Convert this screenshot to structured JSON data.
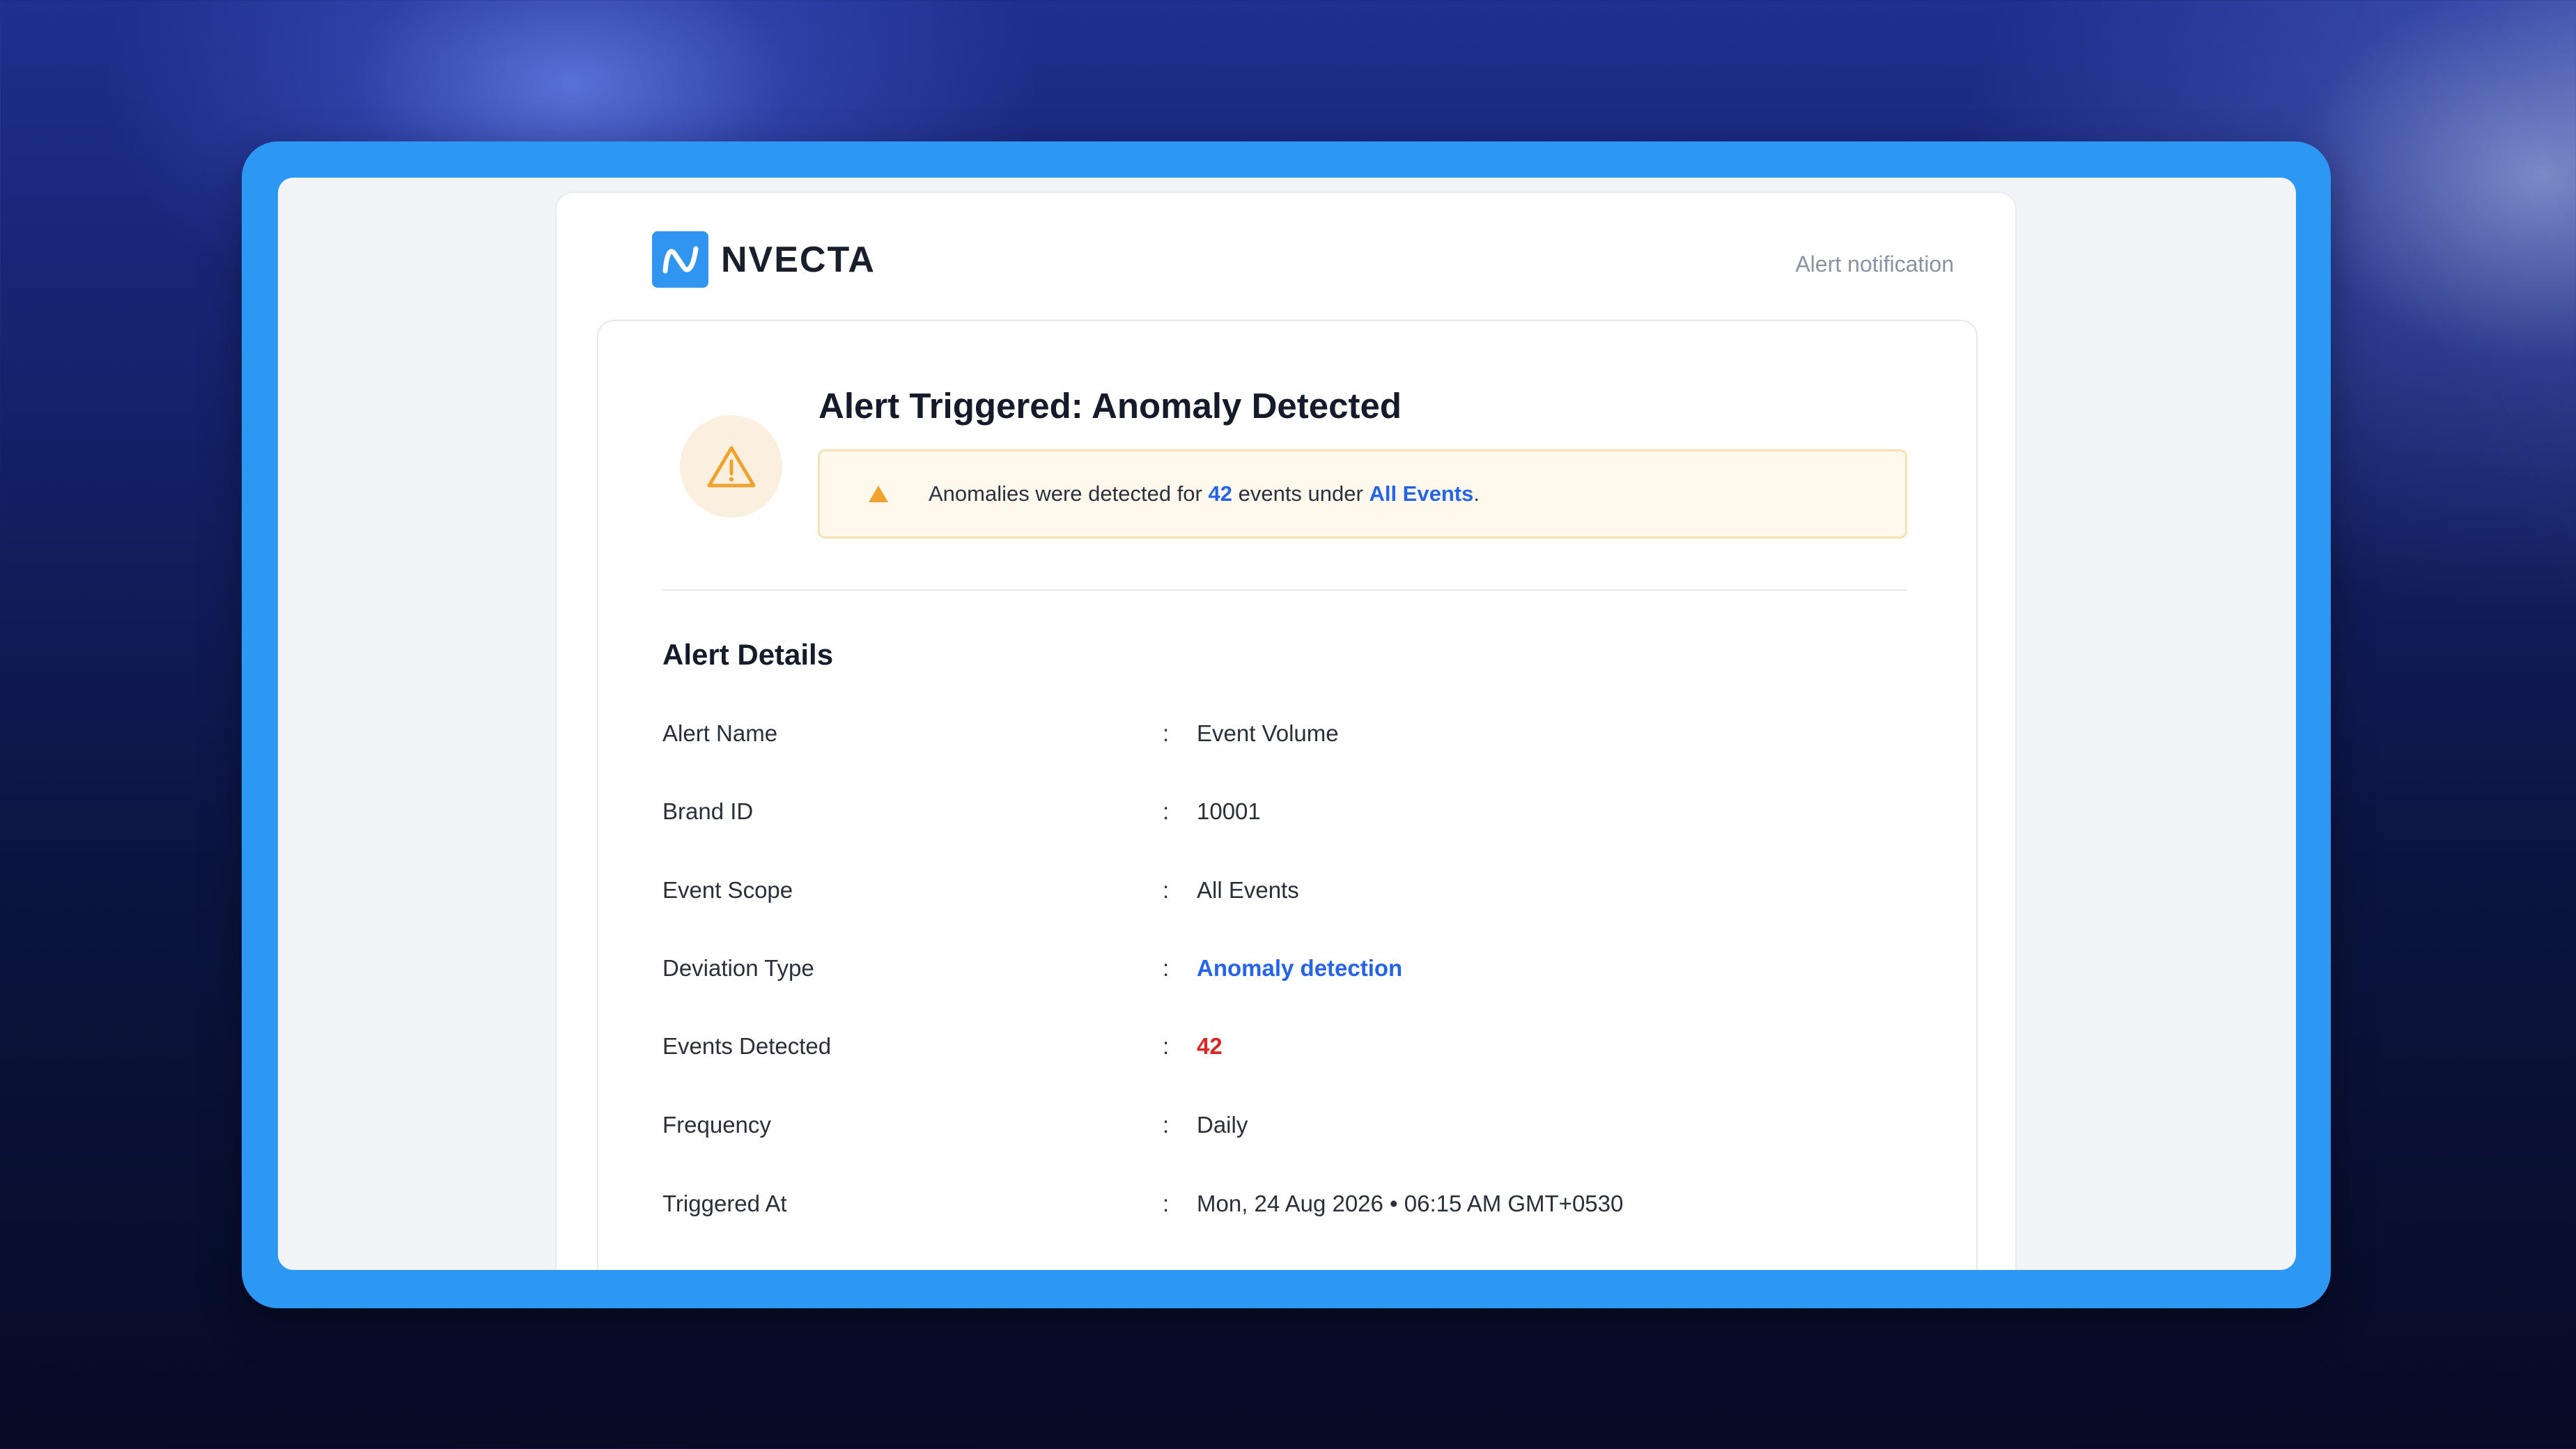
{
  "brand": {
    "name": "NVECTA",
    "color": "#2f95f0"
  },
  "header": {
    "note": "Alert notification"
  },
  "alert": {
    "title": "Alert Triggered: Anomaly Detected",
    "banner_prefix": "Anomalies were detected for ",
    "banner_count": "42",
    "banner_middle": " events under ",
    "banner_scope": "All Events",
    "banner_suffix": ".",
    "icon": "warning-triangle-icon",
    "warning_color": "#f0a32c"
  },
  "details": {
    "title": "Alert Details",
    "separator": ":",
    "rows": [
      {
        "label": "Alert Name",
        "value": "Event Volume",
        "style": "normal"
      },
      {
        "label": "Brand ID",
        "value": "10001",
        "style": "normal"
      },
      {
        "label": "Event Scope",
        "value": "All Events",
        "style": "normal"
      },
      {
        "label": "Deviation Type",
        "value": "Anomaly detection",
        "style": "blue"
      },
      {
        "label": "Events Detected",
        "value": "42",
        "style": "red"
      },
      {
        "label": "Frequency",
        "value": "Daily",
        "style": "normal"
      },
      {
        "label": "Triggered At",
        "value": "Mon, 24 Aug 2026 • 06:15 AM GMT+0530",
        "style": "normal"
      }
    ]
  },
  "colors": {
    "frame": "#2d98f3",
    "link": "#2563eb",
    "danger": "#dc2626"
  }
}
